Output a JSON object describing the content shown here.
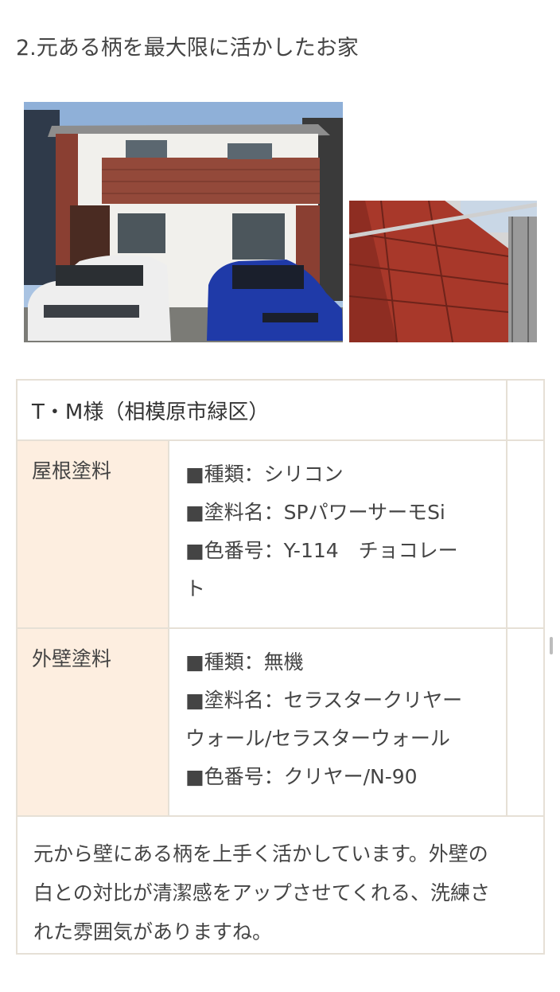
{
  "heading": "2.元ある柄を最大限に活かしたお家",
  "table": {
    "title": "T・M様（相模原市緑区）",
    "rows": [
      {
        "label": "屋根塗料",
        "lines": [
          "■種類：シリコン",
          "■塗料名：SPパワーサーモSi",
          "■色番号：Y-114　チョコレー",
          "ト"
        ]
      },
      {
        "label": "外壁塗料",
        "lines": [
          "■種類：無機",
          "■塗料名：セラスタークリヤー",
          "ウォール/セラスターウォール",
          "■色番号：クリヤー/N-90"
        ]
      }
    ],
    "note_lines": [
      "元から壁にある柄を上手く活かしています。外壁の",
      "白との対比が清潔感をアップさせてくれる、洗練さ",
      "れた雰囲気がありますね。"
    ]
  }
}
